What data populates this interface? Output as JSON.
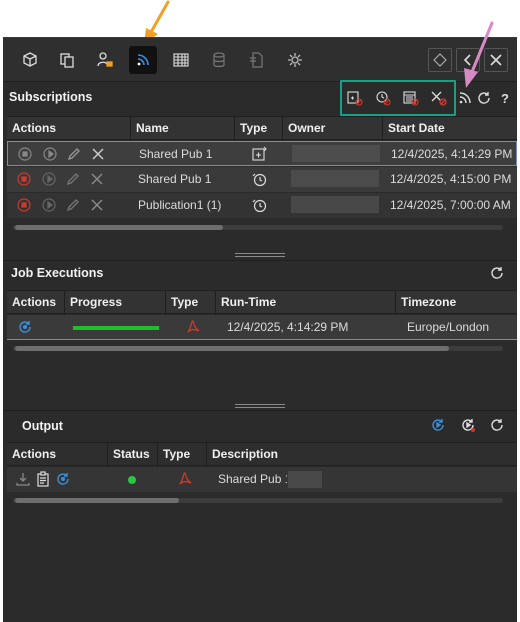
{
  "colors": {
    "annotation_orange": "#f0a024",
    "annotation_pink": "#d88ac4",
    "highlight_green": "#16a085",
    "progress_green": "#1fbf2c",
    "status_green": "#27c93f",
    "pdf_red": "#d0392b",
    "accent_blue": "#3a8fdc"
  },
  "toolbar": {
    "icons": [
      "cube-icon",
      "copy-icon",
      "user-lock-icon",
      "rss-feed-icon",
      "grid-icon",
      "database-icon",
      "document-icon",
      "settings-icon"
    ],
    "active": "rss-feed-icon"
  },
  "subscriptions": {
    "title": "Subscriptions",
    "columns": [
      "Actions",
      "Name",
      "Type",
      "Owner",
      "Start Date"
    ],
    "rows": [
      {
        "name": "Shared Pub 1",
        "type_icon": "publication-type-icon",
        "start_date": "12/4/2025, 4:14:29 PM",
        "selected": true
      },
      {
        "name": "Shared Pub 1",
        "type_icon": "schedule-type-icon",
        "start_date": "12/4/2025, 4:15:00 PM",
        "selected": false
      },
      {
        "name": "Publication1 (1)",
        "type_icon": "schedule-type-icon",
        "start_date": "12/4/2025, 7:00:00 AM",
        "selected": false
      }
    ]
  },
  "job_executions": {
    "title": "Job Executions",
    "columns": [
      "Actions",
      "Progress",
      "Type",
      "Run-Time",
      "Timezone"
    ],
    "rows": [
      {
        "progress": 1.0,
        "run_time": "12/4/2025, 4:14:29 PM",
        "timezone": "Europe/London"
      }
    ]
  },
  "output": {
    "title": "Output",
    "columns": [
      "Actions",
      "Status",
      "Type",
      "Description"
    ],
    "rows": [
      {
        "status": "success",
        "description": "Shared Pub 1"
      }
    ]
  }
}
